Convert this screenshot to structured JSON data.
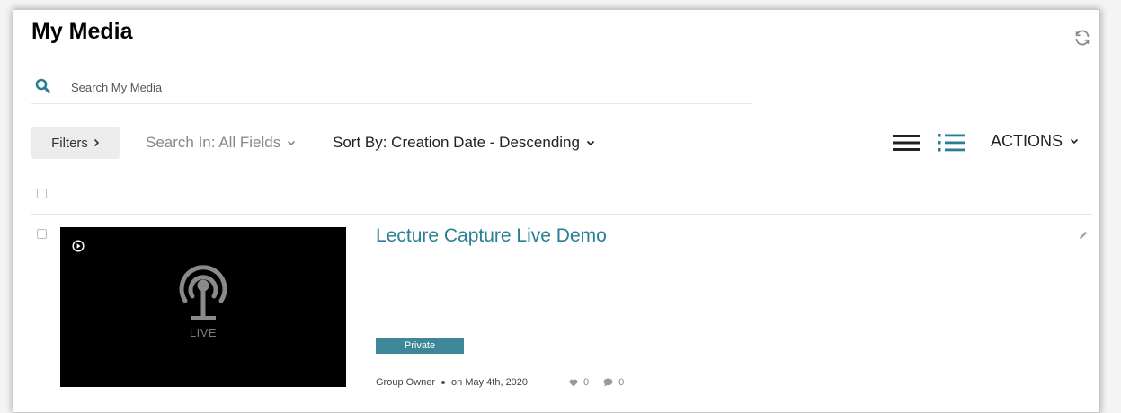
{
  "header": {
    "title": "My Media"
  },
  "search": {
    "placeholder": "Search My Media"
  },
  "toolbar": {
    "filters_label": "Filters",
    "search_in_label": "Search In: All Fields",
    "sort_by_label": "Sort By: Creation Date - Descending",
    "actions_label": "ACTIONS"
  },
  "entries": [
    {
      "title": "Lecture Capture Live Demo",
      "thumbnail_label": "LIVE",
      "status_badge": "Private",
      "owner": "Group Owner",
      "date": "on May 4th, 2020",
      "likes": "0",
      "comments": "0"
    }
  ],
  "icons": {
    "refresh": "refresh-icon",
    "search": "search-icon",
    "list_view": "list-view-icon",
    "detailed_view": "detailed-view-icon",
    "edit": "pencil-icon",
    "play": "play-icon",
    "live": "broadcast-icon",
    "like": "heart-icon",
    "comment": "comment-icon"
  },
  "colors": {
    "accent": "#2a7e95",
    "badge": "#3d8798",
    "filters_bg": "#ececec"
  }
}
